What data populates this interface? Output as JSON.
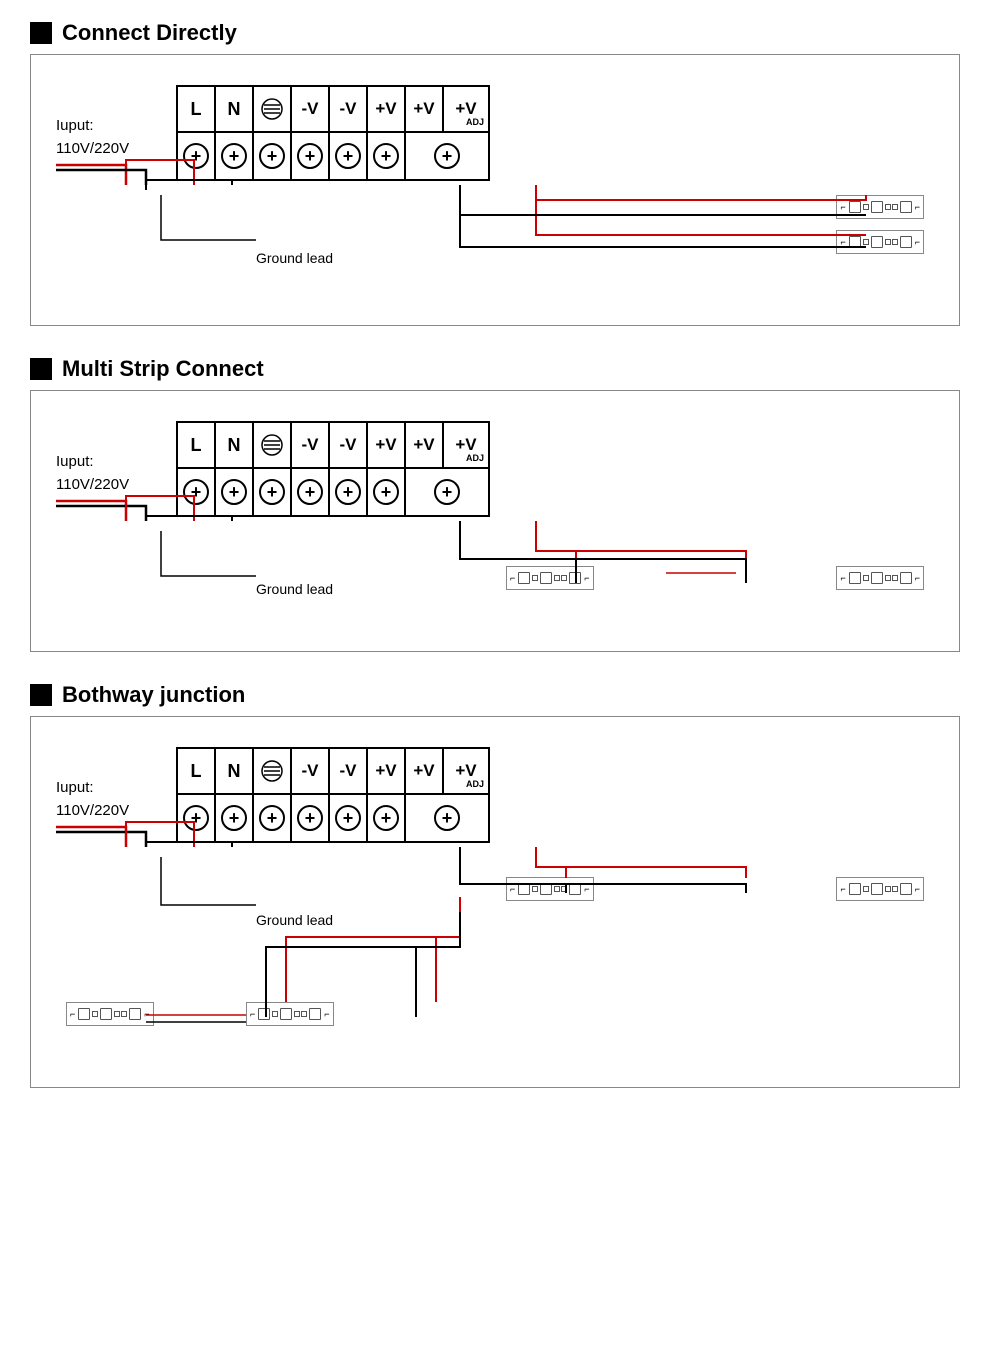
{
  "sections": [
    {
      "id": "connect-directly",
      "title": "Connect Directly",
      "ground_label": "Ground lead",
      "input_label": "Iuput:\n110V/220V"
    },
    {
      "id": "multi-strip",
      "title": "Multi Strip Connect",
      "ground_label": "Ground lead",
      "input_label": "Iuput:\n110V/220V"
    },
    {
      "id": "bothway",
      "title": "Bothway junction",
      "ground_label": "Ground lead",
      "input_label": "Iuput:\n110V/220V"
    }
  ],
  "terminal_labels": [
    "L",
    "N",
    "⊜",
    "-V",
    "-V",
    "+V",
    "+V",
    "+V"
  ],
  "terminal_adj": "ADJ"
}
